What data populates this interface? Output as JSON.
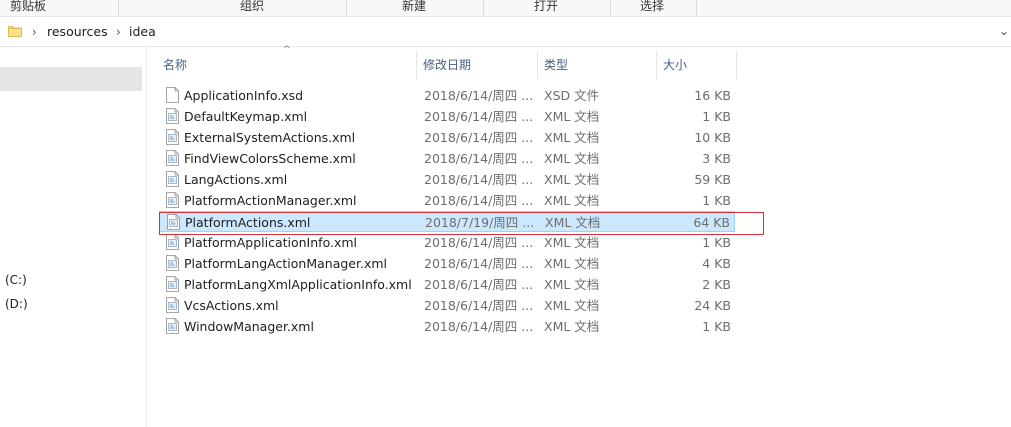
{
  "ribbon": {
    "groups": [
      "剪贴板",
      "组织",
      "新建",
      "打开",
      "选择"
    ]
  },
  "address": {
    "crumbs": [
      "resources",
      "idea"
    ],
    "folder_icon": "folder-icon",
    "chevron_icon": "chevron-right-icon",
    "dropdown_icon": "chevron-down-icon"
  },
  "nav": {
    "drives": [
      "(C:)",
      "(D:)"
    ]
  },
  "list": {
    "columns": [
      "名称",
      "修改日期",
      "类型",
      "大小"
    ],
    "sort_indicator": "^",
    "rows": [
      {
        "name": "ApplicationInfo.xsd",
        "date": "2018/6/14/周四 ...",
        "type": "XSD 文件",
        "size": "16 KB",
        "icon": "xsd-file-icon"
      },
      {
        "name": "DefaultKeymap.xml",
        "date": "2018/6/14/周四 ...",
        "type": "XML 文档",
        "size": "1 KB",
        "icon": "xml-file-icon"
      },
      {
        "name": "ExternalSystemActions.xml",
        "date": "2018/6/14/周四 ...",
        "type": "XML 文档",
        "size": "10 KB",
        "icon": "xml-file-icon"
      },
      {
        "name": "FindViewColorsScheme.xml",
        "date": "2018/6/14/周四 ...",
        "type": "XML 文档",
        "size": "3 KB",
        "icon": "xml-file-icon"
      },
      {
        "name": "LangActions.xml",
        "date": "2018/6/14/周四 ...",
        "type": "XML 文档",
        "size": "59 KB",
        "icon": "xml-file-icon"
      },
      {
        "name": "PlatformActionManager.xml",
        "date": "2018/6/14/周四 ...",
        "type": "XML 文档",
        "size": "1 KB",
        "icon": "xml-file-icon"
      },
      {
        "name": "PlatformActions.xml",
        "date": "2018/7/19/周四 ...",
        "type": "XML 文档",
        "size": "64 KB",
        "icon": "xml-file-icon",
        "selected": true
      },
      {
        "name": "PlatformApplicationInfo.xml",
        "date": "2018/6/14/周四 ...",
        "type": "XML 文档",
        "size": "1 KB",
        "icon": "xml-file-icon"
      },
      {
        "name": "PlatformLangActionManager.xml",
        "date": "2018/6/14/周四 ...",
        "type": "XML 文档",
        "size": "4 KB",
        "icon": "xml-file-icon"
      },
      {
        "name": "PlatformLangXmlApplicationInfo.xml",
        "date": "2018/6/14/周四 ...",
        "type": "XML 文档",
        "size": "2 KB",
        "icon": "xml-file-icon"
      },
      {
        "name": "VcsActions.xml",
        "date": "2018/6/14/周四 ...",
        "type": "XML 文档",
        "size": "24 KB",
        "icon": "xml-file-icon"
      },
      {
        "name": "WindowManager.xml",
        "date": "2018/6/14/周四 ...",
        "type": "XML 文档",
        "size": "1 KB",
        "icon": "xml-file-icon"
      }
    ]
  },
  "colors": {
    "selection_bg": "#cce8ff",
    "selection_border": "#99d1ff",
    "annotation_red": "#d0343a",
    "header_text": "#4c607a"
  }
}
